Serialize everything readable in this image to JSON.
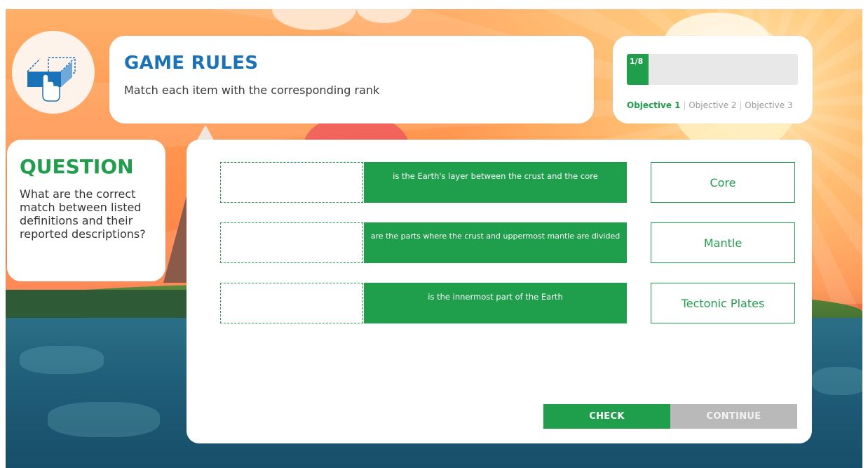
{
  "colors": {
    "accent_green": "#1f9e4b",
    "title_blue": "#1a73b9",
    "disabled_gray": "#b9b9b9",
    "sky_orange": "#ff8a4a",
    "sea_blue": "#1f5d78"
  },
  "rules": {
    "icon": "drag-and-drop-hand-icon",
    "title": "GAME RULES",
    "text": "Match each item with the corresponding rank"
  },
  "progress": {
    "label": "1/8",
    "current": 1,
    "total": 8,
    "objectives": [
      {
        "label": "Objective 1",
        "active": true
      },
      {
        "label": "Objective 2",
        "active": false
      },
      {
        "label": "Objective 3",
        "active": false
      }
    ],
    "separator": "|"
  },
  "question": {
    "title": "QUESTION",
    "text": "What are the correct match between listed definitions and their reported descriptions?"
  },
  "definitions": [
    {
      "text": "is the Earth's layer between the crust and the core"
    },
    {
      "text": "are the parts where the crust and uppermost mantle are divided"
    },
    {
      "text": "is the innermost part of the Earth"
    }
  ],
  "answers": [
    {
      "label": "Core"
    },
    {
      "label": "Mantle"
    },
    {
      "label": "Tectonic Plates"
    }
  ],
  "buttons": {
    "check": "CHECK",
    "continue": "CONTINUE"
  }
}
